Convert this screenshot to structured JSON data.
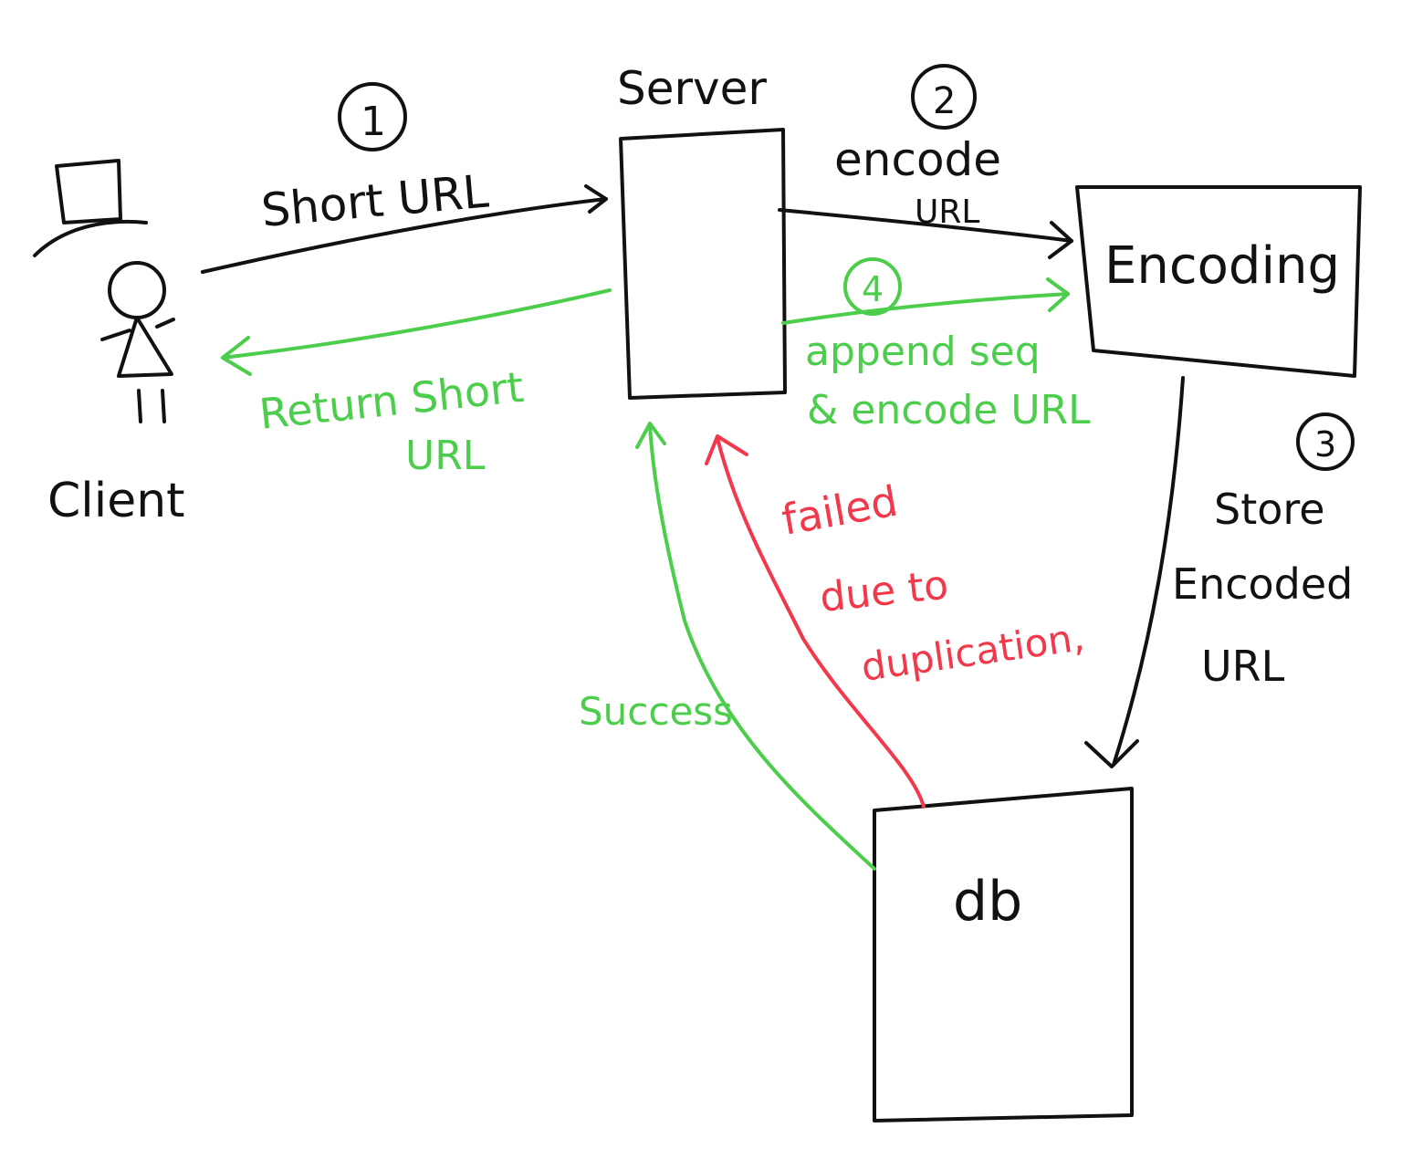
{
  "nodes": {
    "client": {
      "label": "Client"
    },
    "server": {
      "label": "Server"
    },
    "encoding": {
      "label": "Encoding"
    },
    "db": {
      "label": "db"
    }
  },
  "steps": {
    "step1": {
      "number": "1",
      "label": "Short URL"
    },
    "step2": {
      "number": "2",
      "label_line1": "encode",
      "label_line2": "URL"
    },
    "step3": {
      "number": "3",
      "label_line1": "Store",
      "label_line2": "Encoded",
      "label_line3": "URL"
    },
    "step4": {
      "number": "4",
      "label_line1": "append seq",
      "label_line2": "& encode URL"
    }
  },
  "returns": {
    "return_short": {
      "label_line1": "Return Short",
      "label_line2": "URL"
    },
    "success": {
      "label": "Success"
    },
    "failed": {
      "label_line1": "failed",
      "label_line2": "due to",
      "label_line3": "duplication,"
    }
  },
  "colors": {
    "ink": "#111111",
    "success": "#4cce4c",
    "failure": "#f2384a"
  }
}
